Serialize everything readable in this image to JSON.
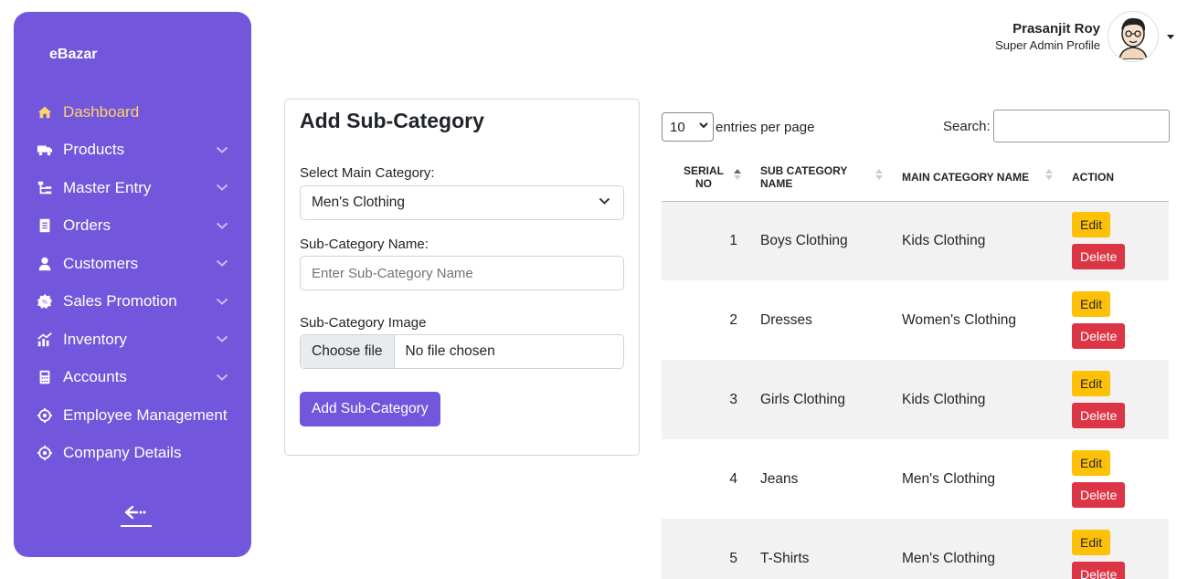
{
  "brand": "eBazar",
  "colors": {
    "accent": "#7257dc",
    "active": "#fdd36b",
    "edit": "#ffc107",
    "delete": "#dc3545"
  },
  "sidebar": {
    "items": [
      {
        "label": "Dashboard",
        "icon": "home-icon",
        "active": true
      },
      {
        "label": "Products",
        "icon": "truck-icon"
      },
      {
        "label": "Master Entry",
        "icon": "hierarchy-icon"
      },
      {
        "label": "Orders",
        "icon": "document-icon"
      },
      {
        "label": "Customers",
        "icon": "user-icon"
      },
      {
        "label": "Sales Promotion",
        "icon": "discount-badge-icon"
      },
      {
        "label": "Inventory",
        "icon": "chart-icon"
      },
      {
        "label": "Accounts",
        "icon": "calculator-icon"
      },
      {
        "label": "Employee Management",
        "icon": "crosshair-icon"
      },
      {
        "label": "Company Details",
        "icon": "crosshair-icon"
      }
    ]
  },
  "profile": {
    "name": "Prasanjit Roy",
    "role": "Super Admin Profile"
  },
  "form": {
    "title": "Add Sub-Category",
    "main_category_label": "Select Main Category:",
    "main_category_value": "Men's Clothing",
    "sub_name_label": "Sub-Category Name:",
    "sub_name_placeholder": "Enter Sub-Category Name",
    "image_label": "Sub-Category Image",
    "file_button": "Choose file",
    "file_status": "No file chosen",
    "submit": "Add Sub-Category"
  },
  "table": {
    "entries_value": "10",
    "entries_label": "entries per page",
    "search_label": "Search:",
    "headers": {
      "serial": "Serial No",
      "sub": "Sub Category Name",
      "main": "Main Category Name",
      "action": "Action"
    },
    "edit_label": "Edit",
    "delete_label": "Delete",
    "rows": [
      {
        "serial": "1",
        "sub": "Boys Clothing",
        "main": "Kids Clothing"
      },
      {
        "serial": "2",
        "sub": "Dresses",
        "main": "Women's Clothing"
      },
      {
        "serial": "3",
        "sub": "Girls Clothing",
        "main": "Kids Clothing"
      },
      {
        "serial": "4",
        "sub": "Jeans",
        "main": "Men's Clothing"
      },
      {
        "serial": "5",
        "sub": "T-Shirts",
        "main": "Men's Clothing"
      }
    ]
  }
}
